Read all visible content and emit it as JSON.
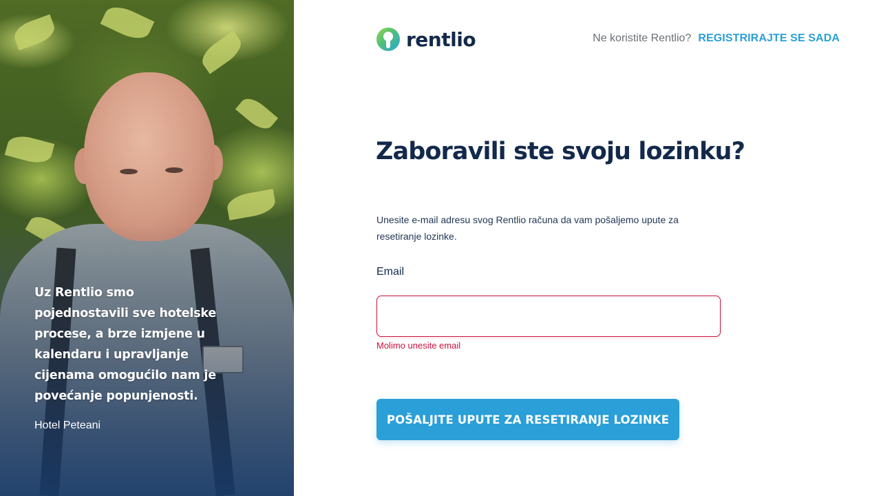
{
  "brand": {
    "logo_icon": "rentlio-keyhole-logo",
    "logo_text": "rentlio",
    "colors": {
      "primary_blue": "#2a9fd8",
      "navy": "#13294b",
      "error_red": "#c8133f"
    }
  },
  "topnav": {
    "prompt": "Ne koristite Rentlio?",
    "register_link": "REGISTRIRAJTE SE SADA"
  },
  "testimonial": {
    "quote": "Uz Rentlio smo pojednostavili sve hotelske procese, a brze izmjene u kalendaru i upravljanje cijenama omogućilo nam je povećanje popunjenosti.",
    "author": "Hotel Peteani"
  },
  "form": {
    "title": "Zaboravili ste svoju lozinku?",
    "description": "Unesite e-mail adresu svog Rentlio računa da vam pošaljemo upute za resetiranje lozinke.",
    "email_label": "Email",
    "email_value": "",
    "email_error": "Molimo unesite email",
    "submit_label": "POŠALJITE UPUTE ZA RESETIRANJE LOZINKE"
  }
}
